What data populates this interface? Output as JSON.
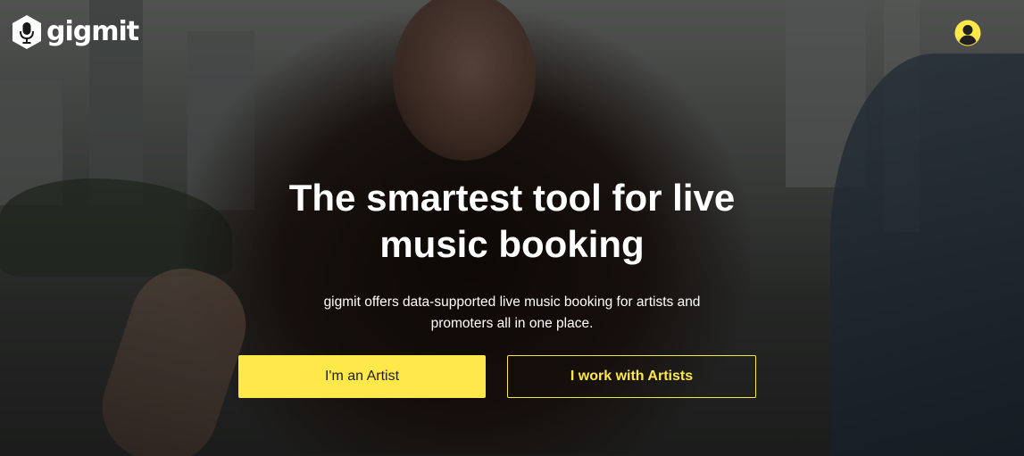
{
  "brand": {
    "name": "gigmit",
    "accent_color": "#ffe84a"
  },
  "header": {
    "account_icon": "user-circle-icon"
  },
  "hero": {
    "headline": "The smartest tool for live music booking",
    "subtext": "gigmit offers data-supported live music booking for artists and promoters all in one place."
  },
  "actions": {
    "artist_label": "I'm an Artist",
    "promoter_label": "I work with Artists"
  }
}
